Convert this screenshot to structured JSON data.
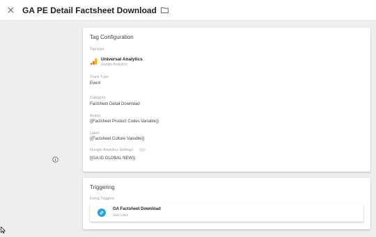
{
  "header": {
    "title": "GA PE Detail Factsheet Download",
    "close_icon": "close-icon",
    "folder_icon": "folder-icon"
  },
  "tag_configuration": {
    "title": "Tag Configuration",
    "tag_type_label": "Tag type",
    "tag_type_name": "Universal Analytics",
    "tag_type_vendor": "Google Analytics",
    "track_type_label": "Track Type",
    "track_type_value": "Event",
    "category_label": "Category",
    "category_value": "Factsheet Detail Download",
    "action_label": "Action",
    "action_value": "{{Factsheet Product Codes Variable}}",
    "label_label": "Label",
    "label_value": "{{Factsheet Culture Variable}}",
    "ga_settings_label": "Google Analytics Settings",
    "ga_settings_value": "{{GA ID GLOBAL NEW}}"
  },
  "triggering": {
    "title": "Triggering",
    "firing_label": "Firing Triggers",
    "triggers": [
      {
        "name": "GA Factsheet Download",
        "type": "Just Links",
        "icon": "link-icon"
      }
    ]
  },
  "colors": {
    "background": "#eeeeee",
    "card": "#ffffff",
    "trigger_icon": "#2ba3db",
    "ga_orange": "#f9ab00",
    "ga_dark_orange": "#e37400"
  }
}
